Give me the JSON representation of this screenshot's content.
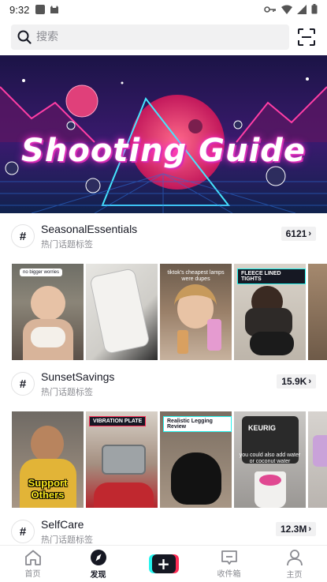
{
  "status_bar": {
    "time": "9:32"
  },
  "search": {
    "placeholder": "搜索"
  },
  "banner": {
    "title": "Shooting Guide"
  },
  "sections": [
    {
      "title": "SeasonalEssentials",
      "subtitle": "热门话题标签",
      "count": "6121",
      "thumbs": [
        {
          "caption": "no bigger worries"
        },
        {
          "caption": ""
        },
        {
          "caption": "tiktok's cheapest lamps were dupes"
        },
        {
          "caption": "FLEECE LINED TIGHTS"
        },
        {
          "caption": ""
        }
      ]
    },
    {
      "title": "SunsetSavings",
      "subtitle": "热门话题标签",
      "count": "15.9K",
      "thumbs": [
        {
          "caption": "Support Others"
        },
        {
          "caption": "VIBRATION PLATE"
        },
        {
          "caption": "Realistic Legging Review"
        },
        {
          "caption": "you could also add water or coconut water"
        },
        {
          "caption": ""
        }
      ]
    },
    {
      "title": "SelfCare",
      "subtitle": "热门话题标签",
      "count": "12.3M"
    }
  ],
  "nav": [
    {
      "label": "首页",
      "icon": "home-icon"
    },
    {
      "label": "发现",
      "icon": "compass-icon"
    },
    {
      "label": "",
      "icon": "plus-icon"
    },
    {
      "label": "收件箱",
      "icon": "inbox-icon"
    },
    {
      "label": "主页",
      "icon": "profile-icon"
    }
  ],
  "colors": {
    "accent_cyan": "#25f4ee",
    "accent_red": "#fe2c55",
    "text": "#161823",
    "muted": "#8a8b91"
  }
}
